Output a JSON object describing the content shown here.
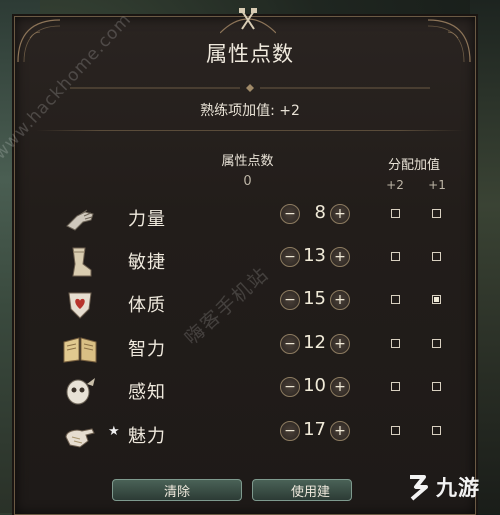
{
  "panel": {
    "title": "属性点数",
    "proficiency_bonus": "熟练项加值: +2",
    "points_header": "属性点数",
    "points_remaining": "0",
    "alloc_header": "分配加值",
    "alloc_plus2": "+2",
    "alloc_plus1": "+1"
  },
  "attributes": [
    {
      "name": "力量",
      "value": "8",
      "icon": "gauntlet-icon",
      "starred": false,
      "plus2": false,
      "plus1": false
    },
    {
      "name": "敏捷",
      "value": "13",
      "icon": "boot-icon",
      "starred": false,
      "plus2": false,
      "plus1": false
    },
    {
      "name": "体质",
      "value": "15",
      "icon": "heart-shield-icon",
      "starred": false,
      "plus2": false,
      "plus1": true
    },
    {
      "name": "智力",
      "value": "12",
      "icon": "open-book-icon",
      "starred": false,
      "plus2": false,
      "plus1": false
    },
    {
      "name": "感知",
      "value": "10",
      "icon": "owl-mask-icon",
      "starred": false,
      "plus2": false,
      "plus1": false
    },
    {
      "name": "魅力",
      "value": "17",
      "icon": "hand-icon",
      "starred": true,
      "plus2": false,
      "plus1": false
    }
  ],
  "controls": {
    "minus": "−",
    "plus": "+",
    "star": "★"
  },
  "buttons": {
    "clear": "清除",
    "use": "使用建"
  },
  "watermarks": {
    "site": "www.hackhome.com",
    "cn": "嗨客手机站",
    "logo_text": "九游"
  },
  "colors": {
    "panel_border": "#6b5a44",
    "button_teal": "#4a6257",
    "text": "#efe9dd"
  }
}
